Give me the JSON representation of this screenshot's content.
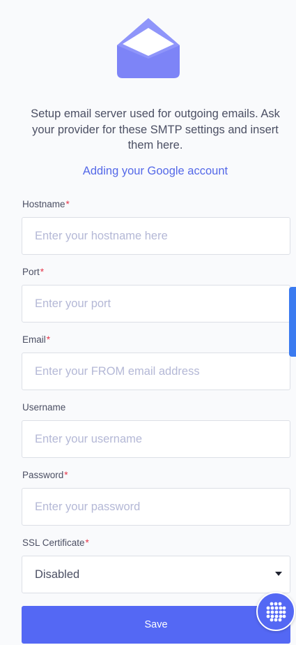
{
  "header": {
    "icon": "envelope-open-icon",
    "description": "Setup email server used for outgoing emails. Ask your provider for these SMTP settings and insert them here.",
    "guide_link": "Adding your Google account"
  },
  "form": {
    "hostname": {
      "label": "Hostname",
      "required_mark": "*",
      "placeholder": "Enter your hostname here",
      "value": ""
    },
    "port": {
      "label": "Port",
      "required_mark": "*",
      "placeholder": "Enter your port",
      "value": ""
    },
    "email": {
      "label": "Email",
      "required_mark": "*",
      "placeholder": "Enter your FROM email address",
      "value": ""
    },
    "username": {
      "label": "Username",
      "placeholder": "Enter your username",
      "value": ""
    },
    "password": {
      "label": "Password",
      "required_mark": "*",
      "placeholder": "Enter your password",
      "value": ""
    },
    "ssl": {
      "label": "SSL Certificate",
      "required_mark": "*",
      "selected": "Disabled"
    },
    "save_label": "Save"
  },
  "colors": {
    "accent": "#5468f4",
    "link": "#5468e8",
    "required": "#e5354a",
    "placeholder": "#b4b8d6",
    "envelope": "#7d84f7",
    "background": "#f9fafc"
  },
  "widgets": {
    "fab_icon": "grid-dots-icon",
    "side_tab": "side-scroll-tab"
  }
}
